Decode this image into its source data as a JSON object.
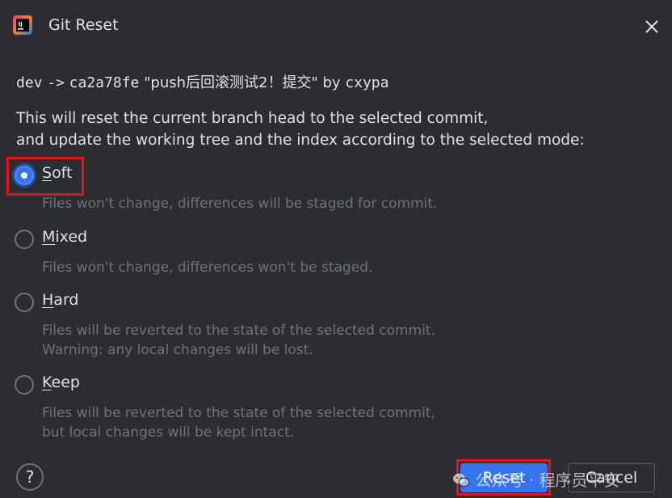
{
  "window": {
    "title": "Git Reset",
    "close_icon": "close-icon"
  },
  "commit": {
    "branch": "dev",
    "arrow": "->",
    "hash": "ca2a78fe",
    "message": "\"push后回滚测试2！提交\"",
    "by": "by",
    "author": "cxypa"
  },
  "description": {
    "line1": "This will reset the current branch head to the selected commit,",
    "line2": "and update the working tree and the index according to the selected mode:"
  },
  "modes": [
    {
      "mnemonic": "S",
      "rest": "oft",
      "selected": true,
      "desc_lines": [
        "Files won't change, differences will be staged for commit."
      ]
    },
    {
      "mnemonic": "M",
      "rest": "ixed",
      "selected": false,
      "desc_lines": [
        "Files won't change, differences won't be staged."
      ]
    },
    {
      "mnemonic": "H",
      "rest": "ard",
      "selected": false,
      "desc_lines": [
        "Files will be reverted to the state of the selected commit.",
        "Warning: any local changes will be lost."
      ]
    },
    {
      "mnemonic": "K",
      "rest": "eep",
      "selected": false,
      "desc_lines": [
        "Files will be reverted to the state of the selected commit,",
        "but local changes will be kept intact."
      ]
    }
  ],
  "footer": {
    "help_label": "?",
    "reset_label": "Reset",
    "cancel_label": "Cancel"
  },
  "watermark": {
    "text": "公众号 · 程序员平安"
  },
  "colors": {
    "background": "#2b2d30",
    "accent": "#3574f0",
    "highlight": "#e5141b",
    "muted_text": "#6f737a"
  }
}
